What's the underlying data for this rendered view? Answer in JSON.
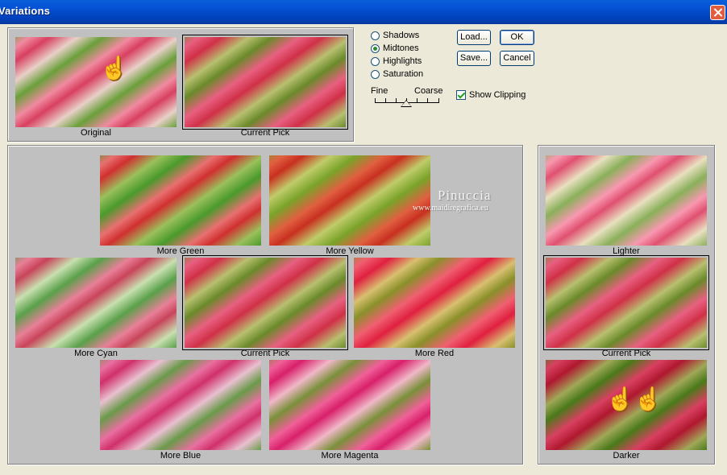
{
  "window": {
    "title": "Variations"
  },
  "preview": {
    "original_label": "Original",
    "current_label": "Current Pick"
  },
  "tones": {
    "options": [
      "Shadows",
      "Midtones",
      "Highlights",
      "Saturation"
    ],
    "selected": "Midtones"
  },
  "buttons": {
    "load": "Load...",
    "ok": "OK",
    "save": "Save...",
    "cancel": "Cancel"
  },
  "slider": {
    "fine": "Fine",
    "coarse": "Coarse"
  },
  "show_clipping": {
    "label": "Show Clipping",
    "checked": true
  },
  "color_grid": {
    "more_green": "More Green",
    "more_yellow": "More Yellow",
    "more_cyan": "More Cyan",
    "current": "Current Pick",
    "more_red": "More Red",
    "more_blue": "More Blue",
    "more_magenta": "More Magenta"
  },
  "brightness": {
    "lighter": "Lighter",
    "current": "Current Pick",
    "darker": "Darker"
  },
  "watermark": {
    "name": "Pinuccia",
    "url": "www.maidiregrafica.eu"
  },
  "icons": {
    "close": "close-icon",
    "hand": "pointing-hand-icon"
  }
}
